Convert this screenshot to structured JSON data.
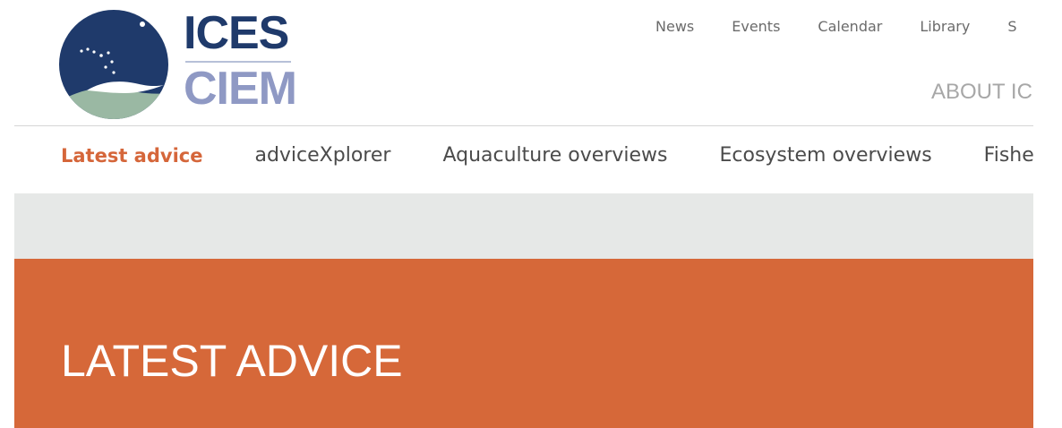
{
  "brand": {
    "line1": "ICES",
    "line2": "CIEM",
    "colors": {
      "navy": "#1f3a6b",
      "lavender": "#8f99c4",
      "sea_green": "#9ab8a3",
      "orange": "#d66839"
    }
  },
  "top_nav": {
    "items": [
      {
        "label": "News"
      },
      {
        "label": "Events"
      },
      {
        "label": "Calendar"
      },
      {
        "label": "Library"
      },
      {
        "label": "S"
      }
    ],
    "about_label": "ABOUT IC"
  },
  "sub_nav": {
    "items": [
      {
        "label": "Latest advice",
        "active": true
      },
      {
        "label": "adviceXplorer",
        "active": false
      },
      {
        "label": "Aquaculture overviews",
        "active": false
      },
      {
        "label": "Ecosystem overviews",
        "active": false
      },
      {
        "label": "Fisheri",
        "active": false
      }
    ],
    "active_color": "#d5663a"
  },
  "hero": {
    "title": "LATEST ADVICE",
    "background": "#d66839"
  },
  "icons": {
    "logo_emblem": "ices-emblem-icon"
  }
}
